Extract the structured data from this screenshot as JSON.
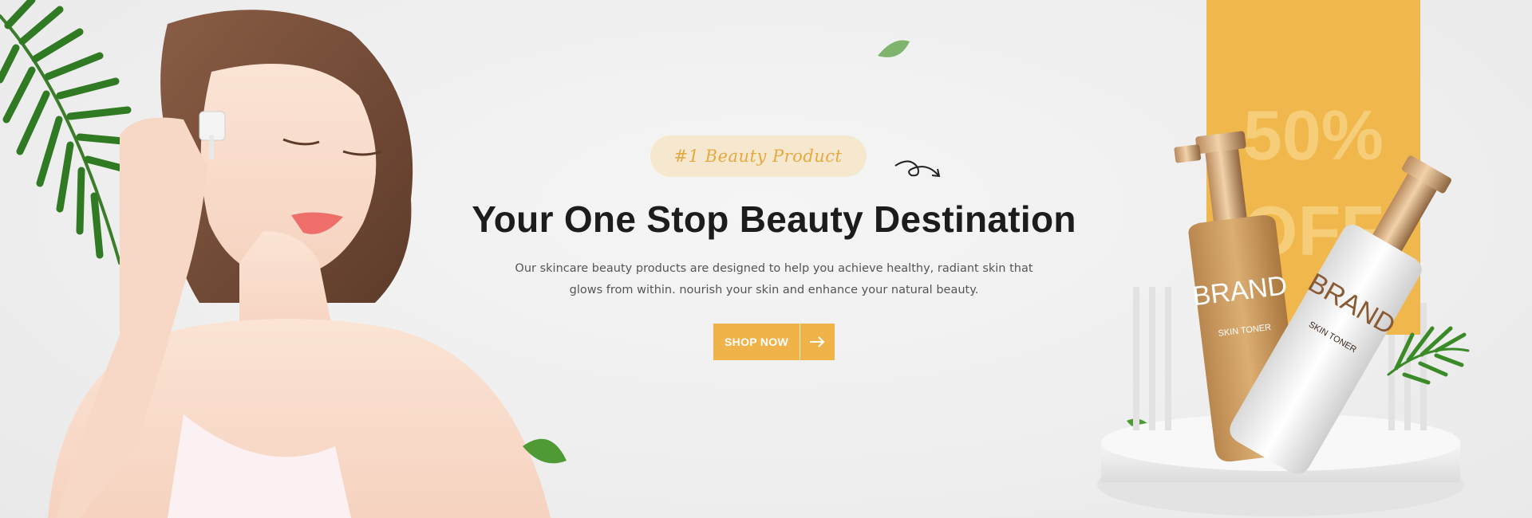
{
  "hero": {
    "badge": "#1 Beauty Product",
    "title": "Your One Stop Beauty Destination",
    "description": "Our skincare beauty products are designed to help you achieve healthy, radiant skin that glows from within. nourish your skin and enhance your natural beauty.",
    "cta_label": "SHOP NOW",
    "cta_icon": "arrow-right-icon"
  },
  "promo": {
    "discount": "50%",
    "off": "OFF"
  },
  "products": [
    {
      "brand": "BRAND",
      "name": "SKIN TONER"
    },
    {
      "brand": "BRAND",
      "name": "SKIN TONER"
    }
  ],
  "colors": {
    "accent": "#f0b34a",
    "badge_bg": "#f6e8cf",
    "heading": "#1c1c1c",
    "body_text": "#555555",
    "background": "#efefef",
    "leaf": "#3f8f2a"
  }
}
